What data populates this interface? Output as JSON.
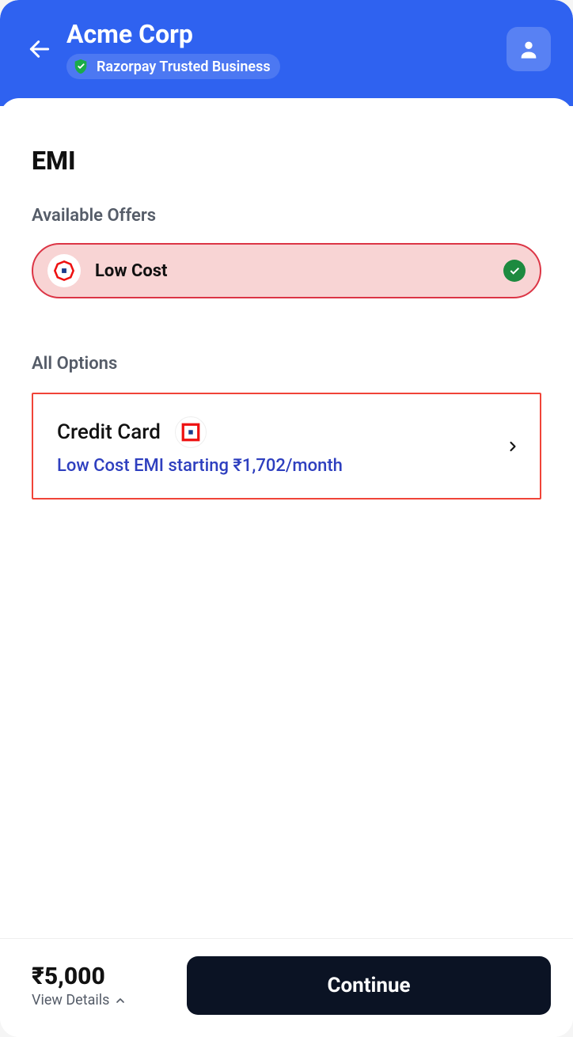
{
  "header": {
    "merchant": "Acme Corp",
    "trust_badge": "Razorpay Trusted Business"
  },
  "page": {
    "title": "EMI",
    "available_offers_label": "Available Offers",
    "all_options_label": "All Options"
  },
  "offer": {
    "label": "Low Cost"
  },
  "option": {
    "title": "Credit Card",
    "subtitle": "Low Cost EMI starting ₹1,702/month"
  },
  "footer": {
    "amount": "₹5,000",
    "view_details": "View Details",
    "continue": "Continue"
  }
}
